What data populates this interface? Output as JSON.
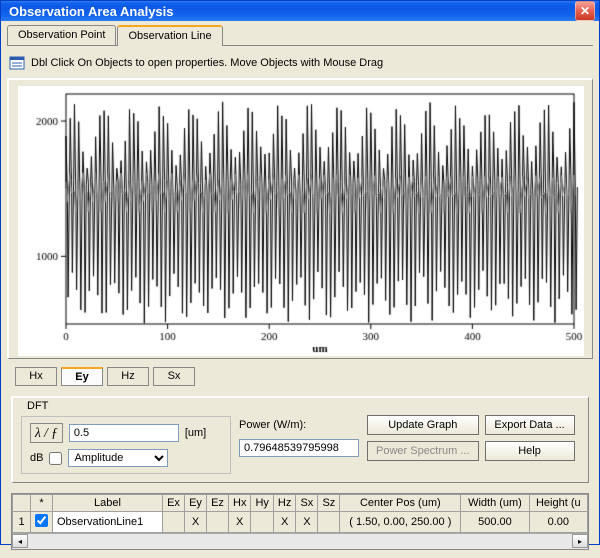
{
  "window": {
    "title": "Observation Area Analysis"
  },
  "tabs": [
    {
      "label": "Observation Point",
      "active": false
    },
    {
      "label": "Observation Line",
      "active": true
    }
  ],
  "hint": "Dbl Click On Objects to open properties.  Move Objects with Mouse Drag",
  "chart_data": {
    "type": "line",
    "xlabel": "um",
    "ylabel": "",
    "xlim": [
      0,
      500
    ],
    "ylim": [
      500,
      2200
    ],
    "xticks": [
      0,
      100,
      200,
      300,
      400,
      500
    ],
    "yticks": [
      1000,
      2000
    ],
    "note": "Dense oscillatory waveform (~120 vertical spikes). Exact per-spike values not readable; envelope approx lower 550–900, upper 1700–2200 with secondary band around 1500."
  },
  "field_tabs": [
    {
      "label": "Hx",
      "active": false
    },
    {
      "label": "Ey",
      "active": true
    },
    {
      "label": "Hz",
      "active": false
    },
    {
      "label": "Sx",
      "active": false
    }
  ],
  "dft": {
    "group_label": "DFT",
    "lambda_f_button": "λ / ƒ",
    "value": "0.5",
    "unit": "[um]",
    "db_label": "dB",
    "db_checked": false,
    "mode": "Amplitude"
  },
  "power": {
    "label": "Power (W/m):",
    "value": "0.79648539795998"
  },
  "buttons": {
    "update": "Update Graph",
    "export": "Export Data ...",
    "spectrum": "Power Spectrum ...",
    "help": "Help"
  },
  "table": {
    "headers": [
      "",
      "*",
      "Label",
      "Ex",
      "Ey",
      "Ez",
      "Hx",
      "Hy",
      "Hz",
      "Sx",
      "Sz",
      "Center Pos (um)",
      "Width (um)",
      "Height (u"
    ],
    "rows": [
      {
        "idx": "1",
        "checked": true,
        "label": "ObservationLine1",
        "Ex": "",
        "Ey": "X",
        "Ez": "",
        "Hx": "X",
        "Hy": "",
        "Hz": "X",
        "Sx": "X",
        "Sz": "",
        "center": "( 1.50, 0.00, 250.00 )",
        "width": "500.00",
        "height": "0.00"
      }
    ]
  }
}
